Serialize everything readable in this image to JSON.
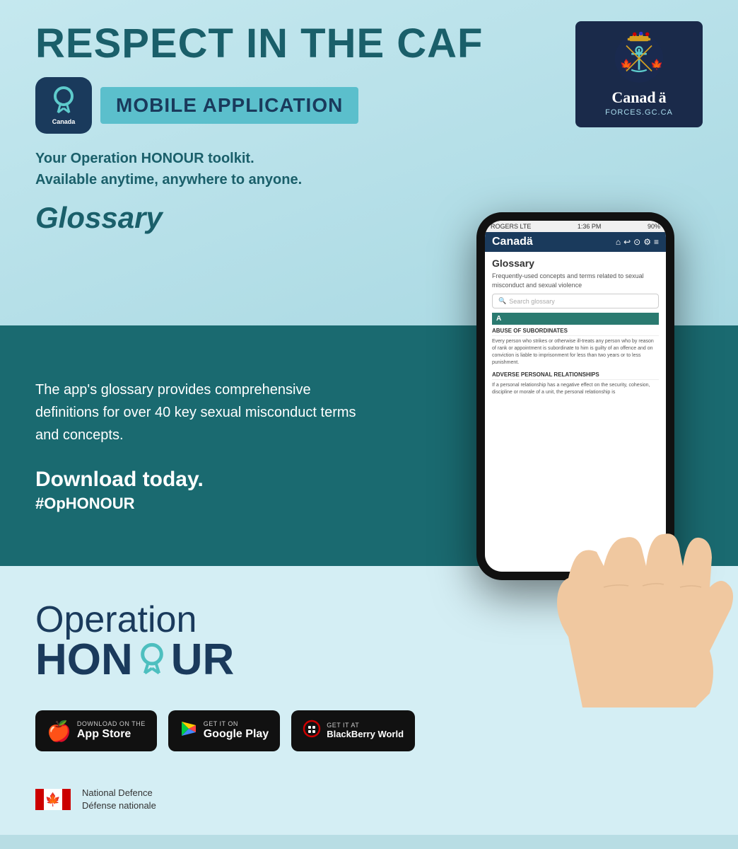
{
  "header": {
    "title": "RESPECT IN THE CAF",
    "app_label": "MOBILE APPLICATION",
    "tagline_line1": "Your Operation HONOUR toolkit.",
    "tagline_line2": "Available anytime, anywhere to anyone.",
    "glossary_title": "Glossary",
    "canada_url": "FORCES.GC.CA"
  },
  "mid_section": {
    "description": "The app's glossary provides comprehensive definitions for over 40 key sexual misconduct terms and concepts.",
    "cta_line1": "Download today.",
    "cta_line2": "#OpHONOUR"
  },
  "phone": {
    "status_bar": {
      "carrier": "ROGERS  LTE",
      "time": "1:36 PM",
      "battery": "90%"
    },
    "page_title": "Glossary",
    "page_subtitle": "Frequently-used concepts and terms related to sexual misconduct and sexual violence",
    "search_placeholder": "Search glossary",
    "letter": "A",
    "terms": [
      {
        "term": "ABUSE OF SUBORDINATES",
        "definition": "Every person who strikes or otherwise ill-treats any person who by reason of rank or appointment is subordinate to him is guilty of an offence and on conviction is liable to imprisonment for less than two years or to less punishment."
      },
      {
        "term": "ADVERSE PERSONAL RELATIONSHIPS",
        "definition": "If a personal relationship has a negative effect on the security, cohesion, discipline or morale of a unit, the personal relationship is"
      }
    ]
  },
  "operation_honour": {
    "operation_text": "Operation",
    "honour_text": "HONOUR"
  },
  "store_badges": [
    {
      "id": "appstore",
      "small_text": "Download on the",
      "big_text": "App Store",
      "icon": "🍎"
    },
    {
      "id": "googleplay",
      "small_text": "GET IT ON",
      "big_text": "Google Play",
      "icon": "▶"
    },
    {
      "id": "blackberry",
      "small_text": "Get it at",
      "big_text": "BlackBerry World",
      "icon": "⬛"
    }
  ],
  "footer": {
    "dept_en": "National Defence",
    "dept_fr": "Défense nationale"
  }
}
